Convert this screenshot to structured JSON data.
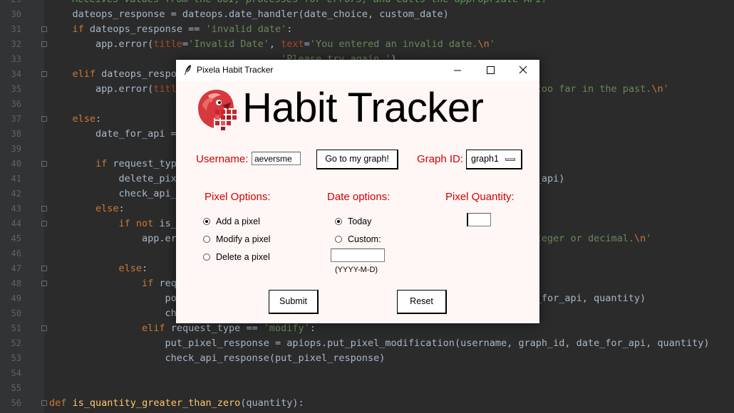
{
  "editor": {
    "lines": [
      {
        "n": "29",
        "fold": false,
        "html": "<span class='cm'>    Receives values from the GUI, processes for errors, and calls the appropriate API.</span>"
      },
      {
        "n": "30",
        "fold": false,
        "html": "    dateops_response = dateops.date_handler(date_choice, custom_date)"
      },
      {
        "n": "31",
        "fold": true,
        "html": "    <span class='kw'>if</span> dateops_response == <span class='str'>'invalid date'</span>:"
      },
      {
        "n": "32",
        "fold": true,
        "html": "        app.error(<span class='par'>title</span>=<span class='str'>'Invalid Date'</span>, <span class='par'>text</span>=<span class='str'>'You entered an invalid date.</span><span class='kw'>\\n</span><span class='str'>'</span>"
      },
      {
        "n": "33",
        "fold": false,
        "html": "<span class='str'>                                        'Please try again.'</span>)"
      },
      {
        "n": "34",
        "fold": true,
        "html": "    <span class='kw'>elif</span> dateops_response == <span class='str'>'out of range'</span>:"
      },
      {
        "n": "35",
        "fold": false,
        "html": "        app.error(<span class='par'>title</span>=<span class='str'>'Out of Range'</span>, <span class='par'>text</span>=<span class='str'>'That date is too far in the future or too far in the past.</span><span class='kw'>\\n</span><span class='str'>'</span>"
      },
      {
        "n": "36",
        "fold": false,
        "html": ""
      },
      {
        "n": "37",
        "fold": true,
        "html": "    <span class='kw'>else</span>:"
      },
      {
        "n": "38",
        "fold": false,
        "html": "        date_for_api = dateops_response"
      },
      {
        "n": "39",
        "fold": false,
        "html": ""
      },
      {
        "n": "40",
        "fold": true,
        "html": "        <span class='kw'>if</span> request_type == <span class='str'>'delete'</span>:"
      },
      {
        "n": "41",
        "fold": false,
        "html": "            delete_pixel_response = apiops.delete_pixel(username, graph_id, date_for_api)"
      },
      {
        "n": "42",
        "fold": false,
        "html": "            check_api_response(delete_pixel_response)"
      },
      {
        "n": "43",
        "fold": true,
        "html": "        <span class='kw'>else</span>:"
      },
      {
        "n": "44",
        "fold": true,
        "html": "            <span class='kw'>if not</span> is_quantity_greater_than_zero(quantity):"
      },
      {
        "n": "45",
        "fold": false,
        "html": "                app.error(<span class='par'>title</span>=<span class='str'>'Invalid Quantity'</span>, <span class='par'>text</span>=<span class='str'>'Please enter a positive integer or decimal.</span><span class='kw'>\\n</span><span class='str'>'</span>"
      },
      {
        "n": "46",
        "fold": false,
        "html": ""
      },
      {
        "n": "47",
        "fold": true,
        "html": "            <span class='kw'>else</span>:"
      },
      {
        "n": "48",
        "fold": true,
        "html": "                <span class='kw'>if</span> request_type == <span class='str'>'add'</span>:"
      },
      {
        "n": "49",
        "fold": false,
        "html": "                    post_pixel_response = apiops.post_pixel(username, graph_id, date_for_api, quantity)"
      },
      {
        "n": "50",
        "fold": false,
        "html": "                    check_api_response(post_pixel_response)"
      },
      {
        "n": "51",
        "fold": true,
        "html": "                <span class='kw'>elif</span> request_type == <span class='str'>'modify'</span>:"
      },
      {
        "n": "52",
        "fold": false,
        "html": "                    put_pixel_response = apiops.put_pixel_modification(username, graph_id, date_for_api, quantity)"
      },
      {
        "n": "53",
        "fold": false,
        "html": "                    check_api_response(put_pixel_response)"
      },
      {
        "n": "54",
        "fold": false,
        "html": ""
      },
      {
        "n": "55",
        "fold": false,
        "html": ""
      },
      {
        "n": "56",
        "fold": true,
        "html": "<span class='kw'>def</span> <span class='fn'>is_quantity_greater_than_zero</span>(quantity):"
      }
    ]
  },
  "window": {
    "title": "Pixela Habit Tracker",
    "heading": "Habit Tracker",
    "username_label": "Username:",
    "username_value": "aeversme",
    "goto_graph_label": "Go to my graph!",
    "graph_id_label": "Graph ID:",
    "graph_id_value": "graph1",
    "pixel_options_label": "Pixel Options:",
    "date_options_label": "Date options:",
    "pixel_quantity_label": "Pixel Quantity:",
    "pixel_options": [
      {
        "label": "Add a pixel",
        "selected": true
      },
      {
        "label": "Modify a pixel",
        "selected": false
      },
      {
        "label": "Delete a pixel",
        "selected": false
      }
    ],
    "date_options": [
      {
        "label": "Today",
        "selected": true
      },
      {
        "label": "Custom:",
        "selected": false
      }
    ],
    "custom_date_value": "",
    "date_format_hint": "(YYYY-M-D)",
    "quantity_value": "",
    "submit_label": "Submit",
    "reset_label": "Reset"
  },
  "colors": {
    "accent_red": "#d10000",
    "editor_bg": "#2b2b2b",
    "window_bg": "#fff7f5"
  },
  "icons": [
    "feather-icon",
    "minimize-icon",
    "maximize-icon",
    "close-icon",
    "pixela-logo-icon",
    "dropdown-indicator-icon"
  ]
}
